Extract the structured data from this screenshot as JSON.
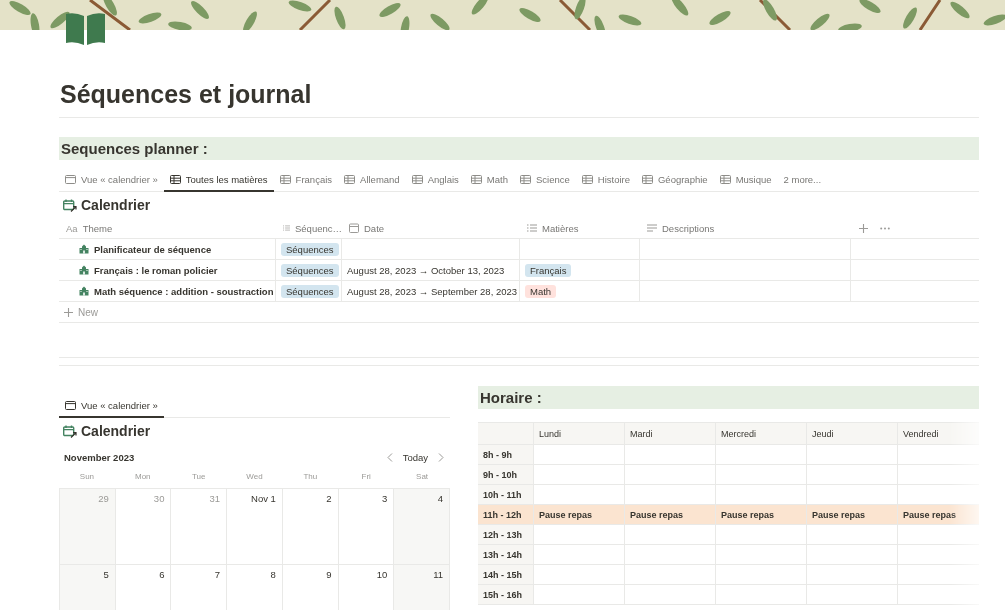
{
  "page": {
    "title": "Séquences et journal"
  },
  "planner": {
    "heading": "Sequences planner :",
    "tabs": [
      {
        "label": "Vue « calendrier »",
        "kind": "calendar",
        "selected": false
      },
      {
        "label": "Toutes les matières",
        "kind": "table",
        "selected": true
      },
      {
        "label": "Français",
        "kind": "table",
        "selected": false
      },
      {
        "label": "Allemand",
        "kind": "table",
        "selected": false
      },
      {
        "label": "Anglais",
        "kind": "table",
        "selected": false
      },
      {
        "label": "Math",
        "kind": "table",
        "selected": false
      },
      {
        "label": "Science",
        "kind": "table",
        "selected": false
      },
      {
        "label": "Histoire",
        "kind": "table",
        "selected": false
      },
      {
        "label": "Géographie",
        "kind": "table",
        "selected": false
      },
      {
        "label": "Musique",
        "kind": "table",
        "selected": false
      },
      {
        "label": "2 more...",
        "kind": "more",
        "selected": false
      }
    ],
    "database": {
      "title": "Calendrier",
      "columns": [
        {
          "label": "Theme",
          "kind": "title",
          "type_label": "Aa"
        },
        {
          "label": "Séquenc…",
          "kind": "list"
        },
        {
          "label": "Date",
          "kind": "date"
        },
        {
          "label": "Matières",
          "kind": "list"
        },
        {
          "label": "Descriptions",
          "kind": "text"
        }
      ],
      "rows": [
        {
          "theme": "Planificateur de séquence",
          "sequence": {
            "label": "Séquences",
            "color": "#d3e5ef"
          }
        },
        {
          "theme": "Français : le roman policier",
          "sequence": {
            "label": "Séquences",
            "color": "#d3e5ef"
          },
          "date": "August 28, 2023 → October 13, 2023",
          "subjects": [
            {
              "label": "Français",
              "color": "#d3e5ef"
            }
          ]
        },
        {
          "theme": "Math séquence : addition - soustraction",
          "sequence": {
            "label": "Séquences",
            "color": "#d3e5ef"
          },
          "date": "August 28, 2023 → September 28, 2023",
          "subjects": [
            {
              "label": "Math",
              "color": "#ffe2dd"
            }
          ]
        }
      ],
      "new_label": "New"
    }
  },
  "calendar_view": {
    "tabs": [
      {
        "label": "Vue « calendrier »",
        "kind": "calendar",
        "selected": true
      }
    ],
    "title": "Calendrier",
    "month": "November 2023",
    "today": "Today",
    "weekdays": [
      "Sun",
      "Mon",
      "Tue",
      "Wed",
      "Thu",
      "Fri",
      "Sat"
    ],
    "weeks": [
      [
        {
          "label": "29",
          "in_month": false
        },
        {
          "label": "30",
          "in_month": false
        },
        {
          "label": "31",
          "in_month": false
        },
        {
          "label": "Nov 1",
          "in_month": true
        },
        {
          "label": "2",
          "in_month": true
        },
        {
          "label": "3",
          "in_month": true
        },
        {
          "label": "4",
          "in_month": true
        }
      ],
      [
        {
          "label": "5",
          "in_month": true
        },
        {
          "label": "6",
          "in_month": true
        },
        {
          "label": "7",
          "in_month": true
        },
        {
          "label": "8",
          "in_month": true
        },
        {
          "label": "9",
          "in_month": true
        },
        {
          "label": "10",
          "in_month": true
        },
        {
          "label": "11",
          "in_month": true
        }
      ]
    ]
  },
  "schedule": {
    "heading": "Horaire :",
    "days": [
      "Lundi",
      "Mardi",
      "Mercredi",
      "Jeudi",
      "Vendredi"
    ],
    "rows": [
      {
        "time": "8h - 9h",
        "highlighted": false
      },
      {
        "time": "9h - 10h",
        "highlighted": false
      },
      {
        "time": "10h - 11h",
        "highlighted": false
      },
      {
        "time": "11h - 12h",
        "highlighted": true,
        "cells": [
          "Pause repas",
          "Pause repas",
          "Pause repas",
          "Pause repas",
          "Pause repas"
        ]
      },
      {
        "time": "12h - 13h",
        "highlighted": false
      },
      {
        "time": "13h - 14h",
        "highlighted": false
      },
      {
        "time": "14h - 15h",
        "highlighted": false
      },
      {
        "time": "15h - 16h",
        "highlighted": false
      }
    ]
  }
}
